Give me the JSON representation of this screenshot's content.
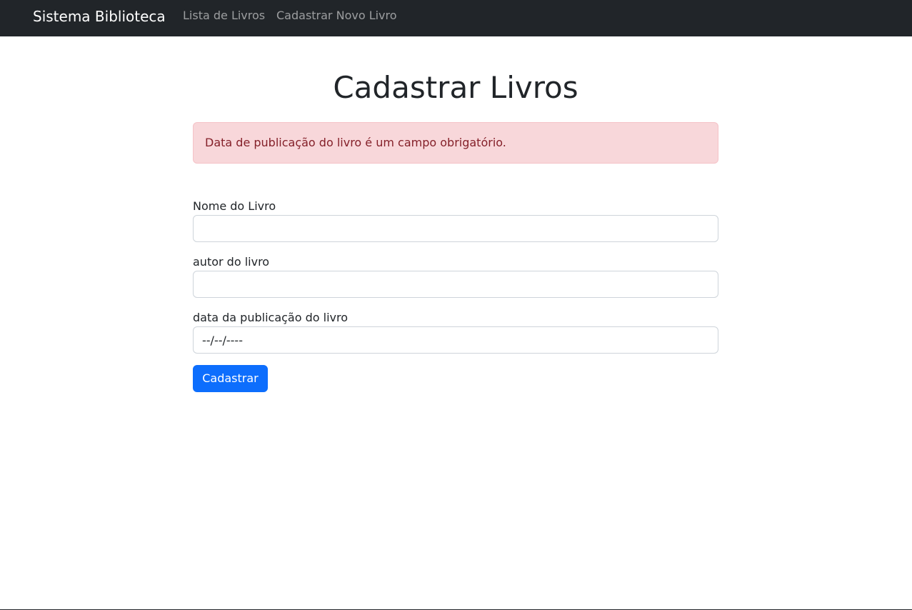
{
  "navbar": {
    "brand": "Sistema Biblioteca",
    "links": [
      {
        "label": "Lista de Livros"
      },
      {
        "label": "Cadastrar Novo Livro"
      }
    ]
  },
  "main": {
    "title": "Cadastrar Livros",
    "alert": {
      "message": "Data de publicação do livro é um campo obrigatório.",
      "color": "#842029",
      "background": "#f8d7da"
    },
    "form": {
      "fields": [
        {
          "label": "Nome do Livro",
          "value": "",
          "placeholder": ""
        },
        {
          "label": "autor do livro",
          "value": "",
          "placeholder": ""
        },
        {
          "label": "data da publicação do livro",
          "value": "",
          "placeholder": "--/--/----"
        }
      ],
      "submit_label": "Cadastrar",
      "submit_color": "#0d6efd"
    }
  }
}
